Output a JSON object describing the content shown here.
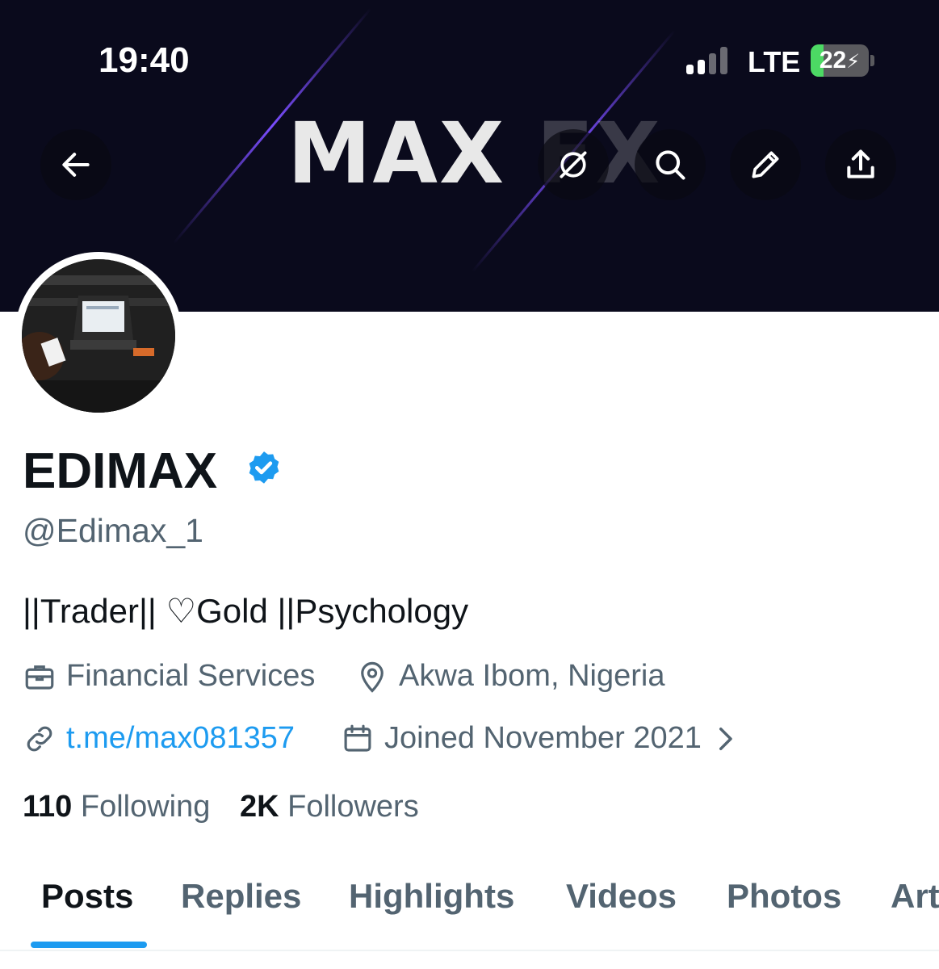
{
  "status_bar": {
    "time": "19:40",
    "network": "LTE",
    "battery": "22",
    "battery_level": 0.22
  },
  "banner": {
    "logo_main": "MAX",
    "logo_fx": "FX"
  },
  "header_actions": {
    "back": "back-arrow-icon",
    "grok": "grok-icon",
    "search": "search-icon",
    "edit": "pencil-icon",
    "share": "share-icon"
  },
  "profile": {
    "name": "EDIMAX",
    "handle": "@Edimax_1",
    "bio": "||Trader|| ♡Gold ||Psychology",
    "category": "Financial Services",
    "location": "Akwa Ibom, Nigeria",
    "website": "t.me/max081357",
    "joined": "Joined November 2021",
    "following_count": "110",
    "following_label": "Following",
    "followers_count": "2K",
    "followers_label": "Followers"
  },
  "colors": {
    "accent": "#1d9bf0",
    "verified": "#1d9bf0",
    "muted": "#536471"
  },
  "tabs": [
    {
      "label": "Posts"
    },
    {
      "label": "Replies"
    },
    {
      "label": "Highlights"
    },
    {
      "label": "Videos"
    },
    {
      "label": "Photos"
    },
    {
      "label": "Art"
    }
  ]
}
